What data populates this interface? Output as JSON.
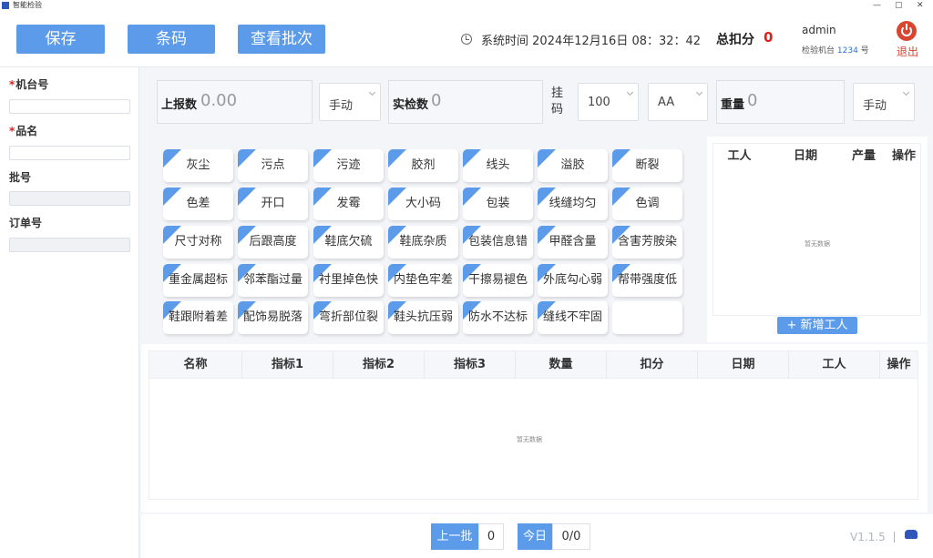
{
  "window": {
    "title": "智能检验",
    "controls": [
      "—",
      "▢",
      "✕"
    ]
  },
  "toolbar": {
    "save_label": "保存",
    "barcode_label": "条码",
    "batch_label": "查看批次",
    "system_time_label": "系统时间",
    "system_time": "2024年12月16日 08：32：42",
    "total_deduction_label": "总扣分",
    "total_deduction": "0",
    "user": "admin",
    "station_prefix": "检验机台",
    "station_number": "1234",
    "station_suffix": "号",
    "exit_label": "退出"
  },
  "sidebar": {
    "machine_label": "机台号",
    "product_label": "品名",
    "batch_label": "批号",
    "order_label": "订单号",
    "required_mark": "*"
  },
  "summary": {
    "reported_label": "上报数",
    "reported_value": "0.00",
    "reported_mode": "手动",
    "inspected_label": "实检数",
    "inspected_value": "0",
    "hang_label": "挂码",
    "hang_value": "100",
    "grade_value": "AA",
    "weight_label": "重量",
    "weight_value": "0",
    "weight_mode": "手动"
  },
  "defects": [
    "灰尘",
    "污点",
    "污迹",
    "胶剂",
    "线头",
    "溢胶",
    "断裂",
    "色差",
    "开口",
    "发霉",
    "大小码",
    "包装",
    "线缝均匀",
    "色调",
    "尺寸对称",
    "后跟高度",
    "鞋底欠硫",
    "鞋底杂质",
    "包装信息错",
    "甲醛含量",
    "含害芳胺染",
    "重金属超标",
    "邻苯酯过量",
    "衬里掉色快",
    "内垫色牢差",
    "干擦易褪色",
    "外底勾心弱",
    "帮带强度低",
    "鞋跟附着差",
    "配饰易脱落",
    "弯折部位裂",
    "鞋头抗压弱",
    "防水不达标",
    "缝线不牢固",
    ""
  ],
  "workers": {
    "columns": [
      "工人",
      "日期",
      "产量",
      "操作"
    ],
    "empty_text": "暂无数据",
    "add_label": "+ 新增工人"
  },
  "records": {
    "columns": [
      "名称",
      "指标1",
      "指标2",
      "指标3",
      "数量",
      "扣分",
      "日期",
      "工人",
      "操作"
    ],
    "empty_text": "暂无数据"
  },
  "footer": {
    "prev_batch_label": "上一批",
    "prev_batch_value": "0",
    "today_label": "今日",
    "today_value": "0/0",
    "version": "V1.1.5",
    "separator": "|"
  },
  "colors": {
    "accent": "#5b9bea",
    "danger": "#e02020",
    "exit": "#d9452f"
  }
}
